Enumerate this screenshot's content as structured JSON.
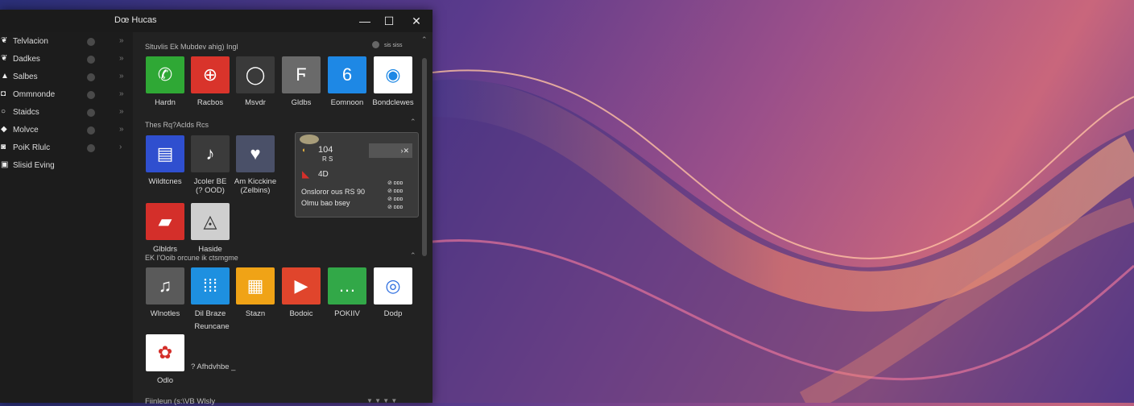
{
  "window": {
    "title": "Dœ Hucas"
  },
  "controls": {
    "minimize": "—",
    "maximize": "☐",
    "close": "✕"
  },
  "sidebar": {
    "items": [
      {
        "label": "Telvlacion"
      },
      {
        "label": "Dadkes"
      },
      {
        "label": "Salbes"
      },
      {
        "label": "Ommnonde"
      },
      {
        "label": "Staidcs"
      },
      {
        "label": "Molvce"
      },
      {
        "label": "PoiK Rlulc"
      },
      {
        "label": "Slisid Eving"
      }
    ]
  },
  "section1": {
    "title": "Sltuvlis Ek Mubdev ahig) Ingl",
    "right_label": "sis siss",
    "tiles": [
      {
        "label": "Hardn",
        "icon": "phone-icon",
        "color": "#2fa835"
      },
      {
        "label": "Racbos",
        "icon": "chat-plus-icon",
        "color": "#d9342b"
      },
      {
        "label": "Msvdr",
        "icon": "circle-chat-icon",
        "color": "#3a3a3a"
      },
      {
        "label": "Gldbs",
        "icon": "shield-f-icon",
        "color": "#6a6a6a"
      },
      {
        "label": "Eomnoon",
        "icon": "six-icon",
        "color": "#1e88e5"
      },
      {
        "label": "Bondclewes",
        "icon": "chrome-icon",
        "color": "#ffffff"
      }
    ]
  },
  "section2": {
    "title": "Thes Rq?Aclds Rcs",
    "tiles": [
      {
        "label": "Wildtcnes",
        "icon": "id-card-icon",
        "color": "#2f4fcf"
      },
      {
        "label": "Jcoler BE\n(? OOD)",
        "icon": "music-note-icon",
        "color": "#3b3b3b"
      },
      {
        "label": "Am Kicckine\n(Zelbins)",
        "icon": "heart-group-icon",
        "color": "#4a5068"
      },
      {
        "label": "Glbldrs",
        "icon": "message-icon",
        "color": "#d42f2a"
      },
      {
        "label": "Haside",
        "icon": "flame-icon",
        "color": "#cfcfcf"
      }
    ]
  },
  "popup": {
    "value1": "104",
    "sub1": "R S",
    "value2": "4D",
    "line1": "Onsloror ous RS 90",
    "line2": "Olmu bao bsey",
    "button": "›✕",
    "list": [
      "⊘ ᴅᴅᴅ",
      "⊘ ᴅᴅᴅ",
      "⊘ ᴅᴅᴅ",
      "⊘ ᴅᴅᴅ"
    ]
  },
  "section3": {
    "title": "EK I'Ooib orcune ik ctsmgme",
    "tiles": [
      {
        "label": "Wlnotles",
        "icon": "music-circle-icon",
        "color": "#5a5a5a"
      },
      {
        "label": "Dil Braze",
        "icon": "dots-icon",
        "color": "#1e90e0"
      },
      {
        "label": "Stazn",
        "icon": "grid-icon",
        "color": "#f0a316"
      },
      {
        "label": "Bodoic",
        "icon": "play-icon",
        "color": "#e0452c"
      },
      {
        "label": "POKIIV",
        "icon": "speech-icon",
        "color": "#32a848"
      },
      {
        "label": "Dodp",
        "icon": "ring-icon",
        "color": "#ffffff"
      },
      {
        "label": "Odlo",
        "icon": "photos-icon",
        "color": "#ffffff"
      }
    ],
    "extra_label": "Reuncane",
    "footer_note": "? Afhdvhbe _"
  },
  "bottom": {
    "text": "Fiinleun (s:\\VB Wlsly",
    "arrows": "▼ ▼ ▼ ▼"
  }
}
